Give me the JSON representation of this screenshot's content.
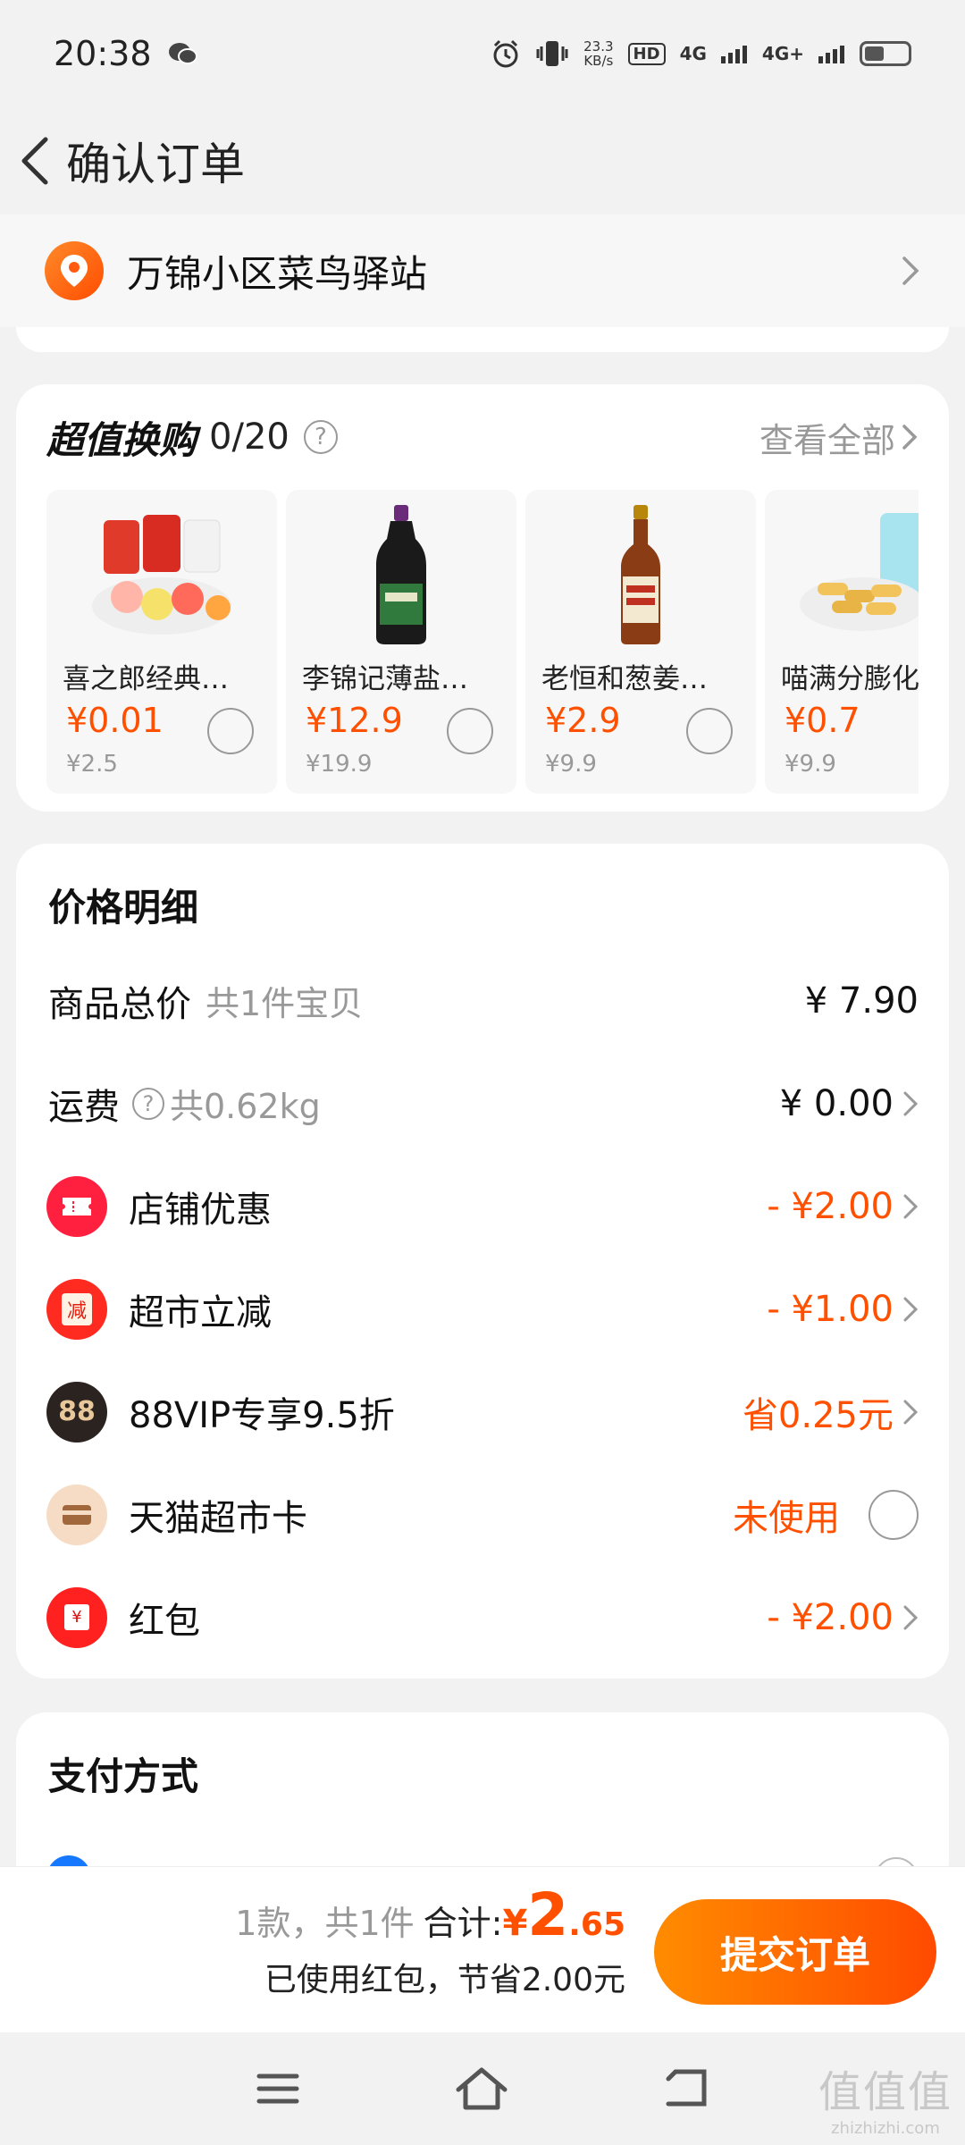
{
  "status_bar": {
    "time": "20:38",
    "net_speed_value": "23.3",
    "net_speed_unit": "KB/s",
    "hd_label": "HD",
    "signal1": "4G",
    "signal2": "4G+"
  },
  "header": {
    "title": "确认订单"
  },
  "address": {
    "label": "万锦小区菜鸟驿站"
  },
  "exchange": {
    "title": "超值换购",
    "count": "0/20",
    "help": "?",
    "see_all": "查看全部",
    "products": [
      {
        "name": "喜之郎经典…",
        "price": "¥0.01",
        "orig": "¥2.5",
        "icon": "jelly-pack"
      },
      {
        "name": "李锦记薄盐…",
        "price": "¥12.9",
        "orig": "¥19.9",
        "icon": "soy-sauce-bottle"
      },
      {
        "name": "老恒和葱姜…",
        "price": "¥2.9",
        "orig": "¥9.9",
        "icon": "cooking-wine-bottle"
      },
      {
        "name": "喵满分膨化",
        "price": "¥0.7",
        "orig": "¥9.9",
        "icon": "puffed-snack"
      }
    ]
  },
  "price_detail": {
    "title": "价格明细",
    "rows": [
      {
        "label": "商品总价",
        "sub": "共1件宝贝",
        "value": "¥ 7.90"
      },
      {
        "label": "运费",
        "sub": "共0.62kg",
        "value": "¥ 0.00"
      },
      {
        "label": "店铺优惠",
        "value": "- ¥2.00"
      },
      {
        "label": "超市立减",
        "value": "- ¥1.00",
        "icon_text": "减"
      },
      {
        "label": "88VIP专享9.5折",
        "value": "省0.25元",
        "icon_text": "88"
      },
      {
        "label": "天猫超市卡",
        "value": "未使用"
      },
      {
        "label": "红包",
        "value": "- ¥2.00",
        "icon_text": "¥"
      }
    ]
  },
  "payment": {
    "title": "支付方式"
  },
  "bottom": {
    "count_text": "1款，共1件",
    "total_label": "合计:",
    "currency": "¥",
    "total_int": "2",
    "total_dec": ".65",
    "saving_text": "已使用红包，节省2.00元",
    "submit": "提交订单"
  },
  "watermark": {
    "big": "值值值",
    "small": "zhizhizhi.com"
  },
  "colors": {
    "accent": "#ff5000",
    "button_start": "#ff8c00",
    "button_end": "#ff4a00",
    "background": "#f2f2f2"
  }
}
